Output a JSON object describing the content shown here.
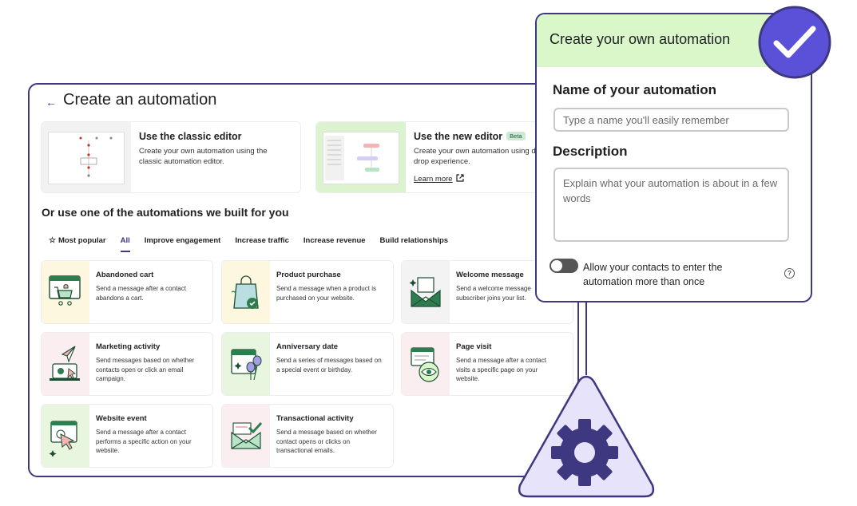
{
  "main": {
    "title": "Create an automation",
    "editors": [
      {
        "name": "Use the classic editor",
        "description": "Create your own automation using the classic automation editor."
      },
      {
        "name": "Use the new editor",
        "badge": "Beta",
        "description": "Create your own automation using drag and drop experience.",
        "link": "Learn more"
      }
    ],
    "section_title": "Or use one of the automations we built for you",
    "tabs": [
      "Most popular",
      "All",
      "Improve engagement",
      "Increase traffic",
      "Increase revenue",
      "Build relationships"
    ],
    "active_tab": "All",
    "templates": [
      {
        "title": "Abandoned cart",
        "description": "Send a message after a contact abandons a cart.",
        "icon": "shopping-cart-icon"
      },
      {
        "title": "Product purchase",
        "description": "Send a message when a product is purchased on your website.",
        "icon": "shopping-bag-icon"
      },
      {
        "title": "Welcome message",
        "description": "Send a welcome message subscriber joins your list.",
        "icon": "envelope-icon"
      },
      {
        "title": "Marketing activity",
        "description": "Send messages based on whether contacts open or click an email campaign.",
        "icon": "paper-plane-icon"
      },
      {
        "title": "Anniversary date",
        "description": "Send a series of messages based on a special event or birthday.",
        "icon": "calendar-balloon-icon"
      },
      {
        "title": "Page visit",
        "description": "Send a message after a contact visits a specific page on your website.",
        "icon": "eye-page-icon"
      },
      {
        "title": "Website event",
        "description": "Send a message after a contact performs a specific action on your website.",
        "icon": "cursor-click-icon"
      },
      {
        "title": "Transactional activity",
        "description": "Send a message based on whether contact opens or clicks on transactional emails.",
        "icon": "envelope-check-icon"
      }
    ]
  },
  "form": {
    "header": "Create your own automation",
    "name_label": "Name of your automation",
    "name_placeholder": "Type a name you'll easily remember",
    "description_label": "Description",
    "description_placeholder": "Explain what your automation is about in a few words",
    "toggle_label": "Allow your contacts to enter the automation more than once",
    "toggle_on": false
  },
  "colors": {
    "accent": "#3d3880",
    "check_badge": "#5b51d8",
    "form_header": "#d9f7c8",
    "illustration_green": "#2e7d4f"
  }
}
